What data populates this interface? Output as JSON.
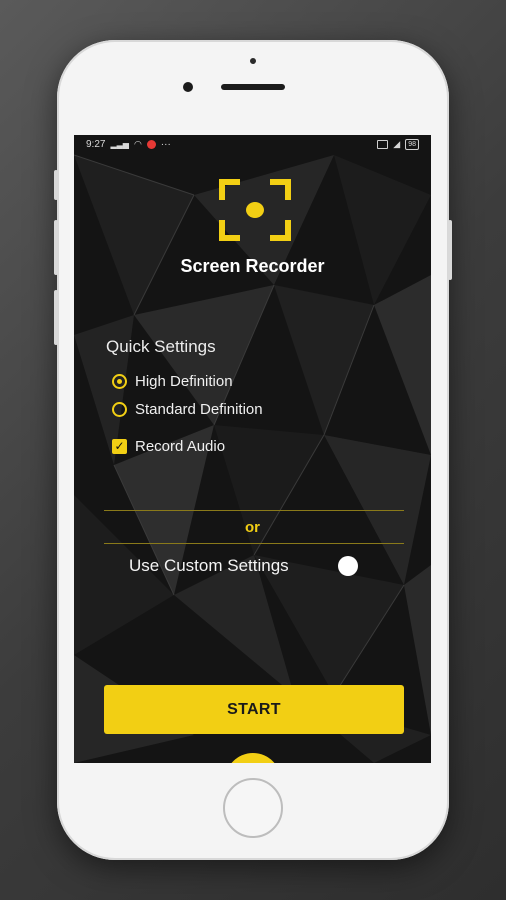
{
  "status_bar": {
    "time": "9:27",
    "battery": "98"
  },
  "app": {
    "title": "Screen Recorder"
  },
  "quick_settings": {
    "title": "Quick Settings",
    "options": [
      {
        "label": "High Definition",
        "selected": true
      },
      {
        "label": "Standard Definition",
        "selected": false
      }
    ],
    "record_audio": {
      "label": "Record Audio",
      "checked": true
    }
  },
  "separator_text": "or",
  "custom_settings": {
    "label": "Use Custom Settings",
    "enabled": false
  },
  "start_button": {
    "label": "START"
  },
  "bottom_nav": {
    "items": [
      "gallery-icon",
      "settings-icon",
      "record-icon",
      "tips-icon",
      "finish-flag-icon"
    ]
  },
  "colors": {
    "accent": "#f2cf14",
    "background": "#151515"
  }
}
